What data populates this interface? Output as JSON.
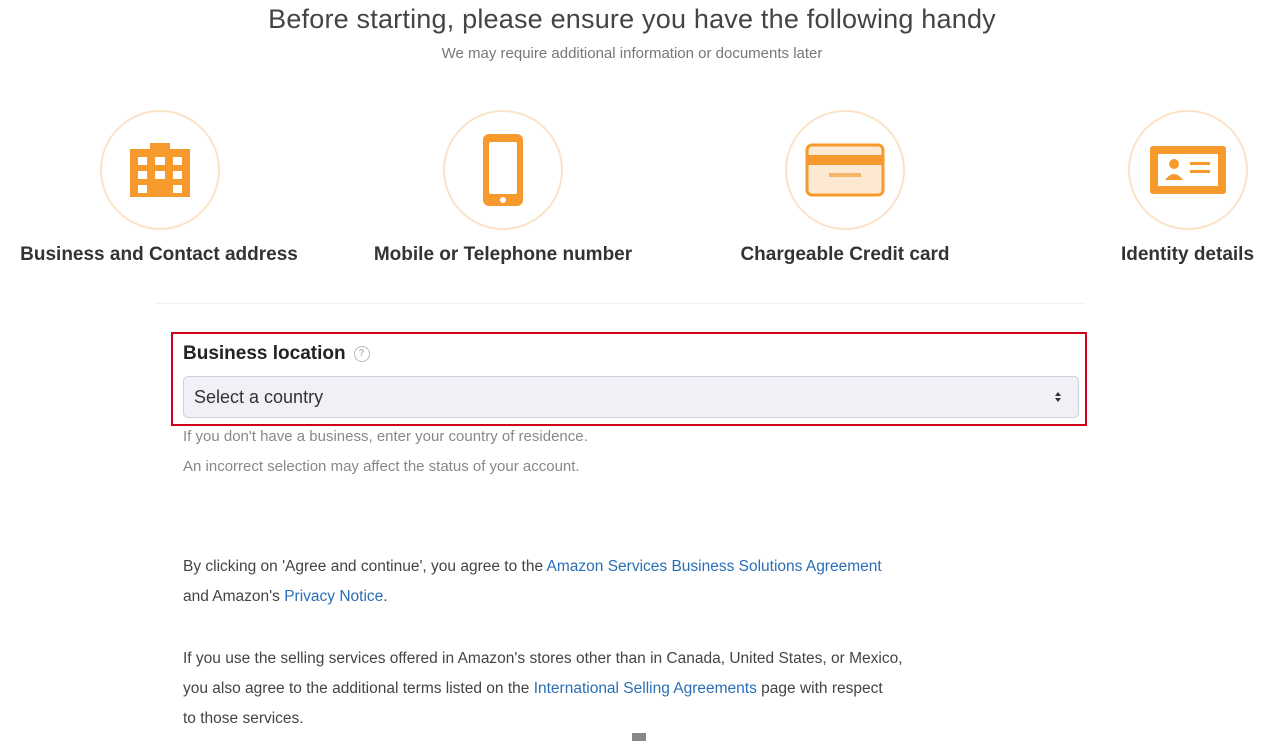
{
  "header": {
    "title": "Before starting, please ensure you have the following handy",
    "subtitle": "We may require additional information or documents later"
  },
  "requirements": [
    {
      "label": "Business and Contact address",
      "icon": "building-icon"
    },
    {
      "label": "Mobile or Telephone number",
      "icon": "mobile-phone-icon"
    },
    {
      "label": "Chargeable Credit card",
      "icon": "credit-card-icon"
    },
    {
      "label": "Identity details",
      "icon": "id-card-icon"
    }
  ],
  "colors": {
    "accent_orange": "#f79a2e",
    "highlight_red": "#d0021b",
    "link_blue": "#2a6fb5"
  },
  "business_location": {
    "label": "Business location",
    "select_value": "Select a country",
    "hint_line1": "If you don't have a business, enter your country of residence.",
    "hint_line2": "An incorrect selection may affect the status of your account."
  },
  "legal": {
    "p1_text_a": "By clicking on 'Agree and continue', you agree to the ",
    "p1_link1": "Amazon Services Business Solutions Agreement",
    "p1_text_b": "and Amazon's ",
    "p1_link2": "Privacy Notice",
    "p1_text_c": ".",
    "p2_text_a": "If you use the selling services offered in Amazon's stores other than in Canada, United States, or Mexico,",
    "p2_text_b": "you also agree to the additional terms listed on the ",
    "p2_link": "International Selling Agreements",
    "p2_text_c": " page with respect",
    "p2_text_d": "to those services."
  }
}
